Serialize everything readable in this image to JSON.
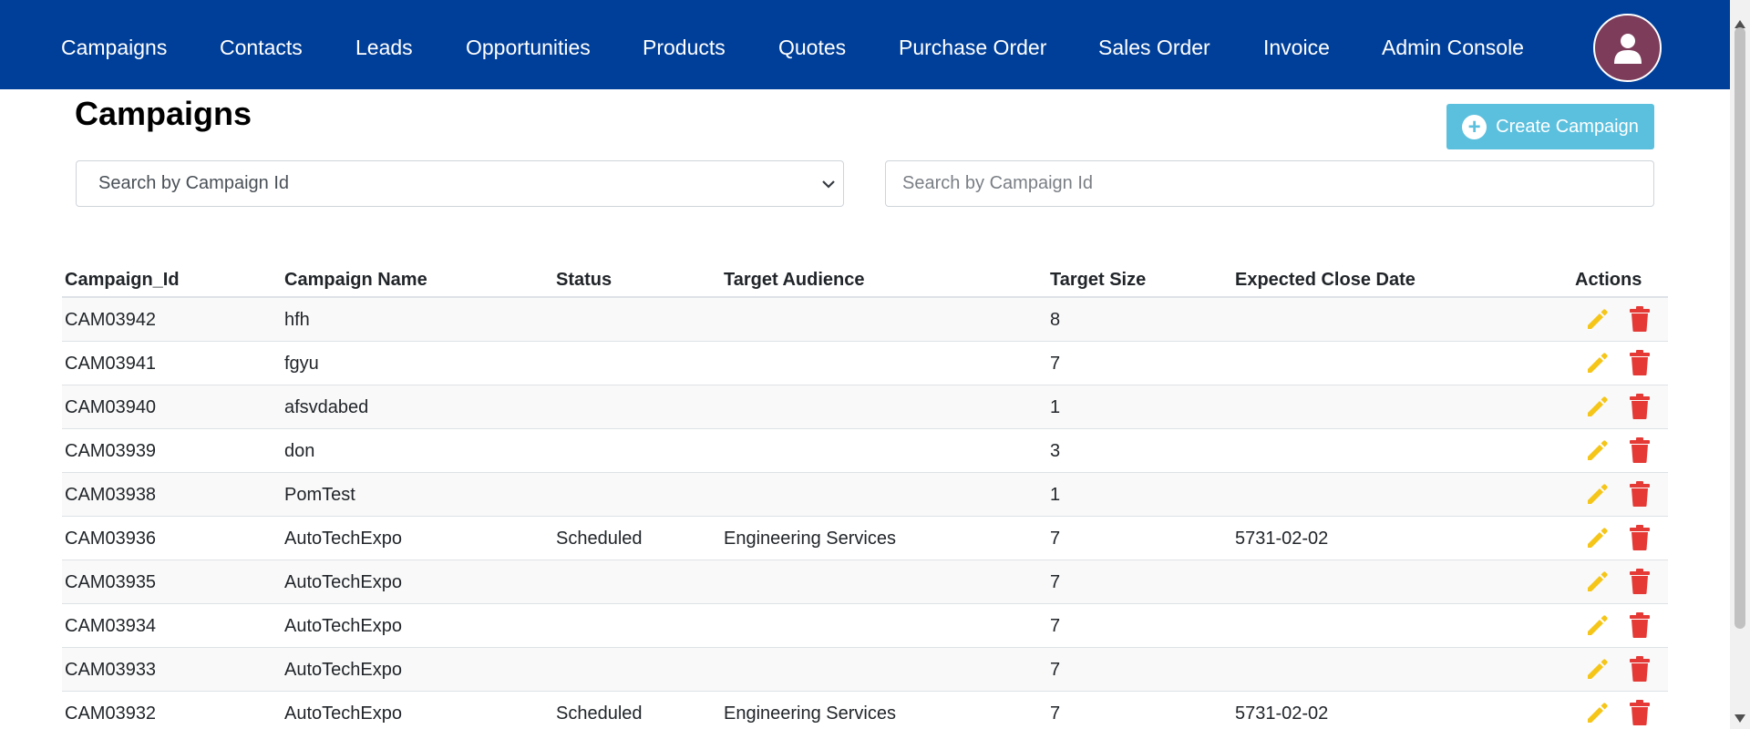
{
  "nav": {
    "items": [
      {
        "label": "Campaigns"
      },
      {
        "label": "Contacts"
      },
      {
        "label": "Leads"
      },
      {
        "label": "Opportunities"
      },
      {
        "label": "Products"
      },
      {
        "label": "Quotes"
      },
      {
        "label": "Purchase Order"
      },
      {
        "label": "Sales Order"
      },
      {
        "label": "Invoice"
      },
      {
        "label": "Admin Console"
      }
    ],
    "avatar_icon": "user-icon"
  },
  "page": {
    "title": "Campaigns",
    "create_label": "Create Campaign"
  },
  "filters": {
    "select_value": "Search by Campaign Id",
    "search_placeholder": "Search by Campaign Id"
  },
  "table": {
    "headers": {
      "id": "Campaign_Id",
      "name": "Campaign Name",
      "status": "Status",
      "audience": "Target Audience",
      "size": "Target Size",
      "close_date": "Expected Close Date",
      "actions": "Actions"
    },
    "rows": [
      {
        "id": "CAM03942",
        "name": "hfh",
        "status": "",
        "audience": "",
        "size": "8",
        "close_date": ""
      },
      {
        "id": "CAM03941",
        "name": "fgyu",
        "status": "",
        "audience": "",
        "size": "7",
        "close_date": ""
      },
      {
        "id": "CAM03940",
        "name": "afsvdabed",
        "status": "",
        "audience": "",
        "size": "1",
        "close_date": ""
      },
      {
        "id": "CAM03939",
        "name": "don",
        "status": "",
        "audience": "",
        "size": "3",
        "close_date": ""
      },
      {
        "id": "CAM03938",
        "name": "PomTest",
        "status": "",
        "audience": "",
        "size": "1",
        "close_date": ""
      },
      {
        "id": "CAM03936",
        "name": "AutoTechExpo",
        "status": "Scheduled",
        "audience": "Engineering Services",
        "size": "7",
        "close_date": "5731-02-02"
      },
      {
        "id": "CAM03935",
        "name": "AutoTechExpo",
        "status": "",
        "audience": "",
        "size": "7",
        "close_date": ""
      },
      {
        "id": "CAM03934",
        "name": "AutoTechExpo",
        "status": "",
        "audience": "",
        "size": "7",
        "close_date": ""
      },
      {
        "id": "CAM03933",
        "name": "AutoTechExpo",
        "status": "",
        "audience": "",
        "size": "7",
        "close_date": ""
      },
      {
        "id": "CAM03932",
        "name": "AutoTechExpo",
        "status": "Scheduled",
        "audience": "Engineering Services",
        "size": "7",
        "close_date": "5731-02-02"
      }
    ]
  },
  "colors": {
    "nav_bg": "#003f99",
    "create_button": "#5bc0de",
    "edit_icon": "#f5c518",
    "delete_icon": "#e53935",
    "avatar_bg": "#7d3c5a"
  }
}
